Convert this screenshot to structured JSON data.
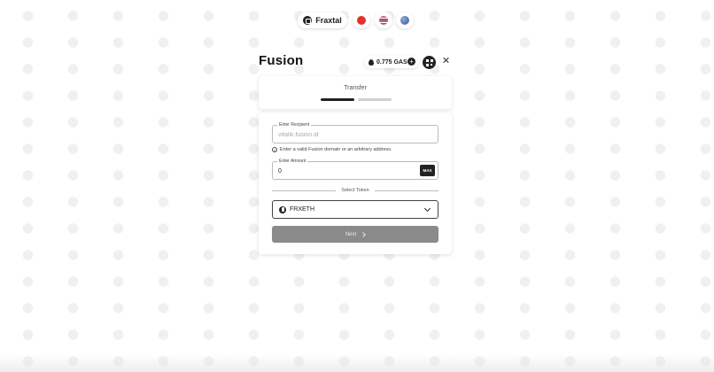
{
  "nav": {
    "brand_label": "Fraxtal",
    "icons": [
      "red-circle-icon",
      "striped-globe-icon",
      "globe-icon"
    ]
  },
  "header": {
    "title": "Fusion",
    "gas_value": "0.775 GAS"
  },
  "steps": {
    "label": "Transfer",
    "current_step": 1,
    "total_steps": 2
  },
  "form": {
    "recipient_label": "Enter Recipient",
    "recipient_placeholder": "vitalik.fusion.id",
    "recipient_value": "",
    "hint_text": "Enter a valid Fusion domain or an arbitrary address.",
    "amount_label": "Enter Amount",
    "amount_value": "0",
    "max_label": "MAX",
    "select_token_label": "Select Token",
    "token_value": "FRXETH",
    "next_label": "Next"
  },
  "colors": {
    "accent": "#222222",
    "next_button": "#8a8a8a",
    "inactive_step": "#cfcfcf"
  }
}
